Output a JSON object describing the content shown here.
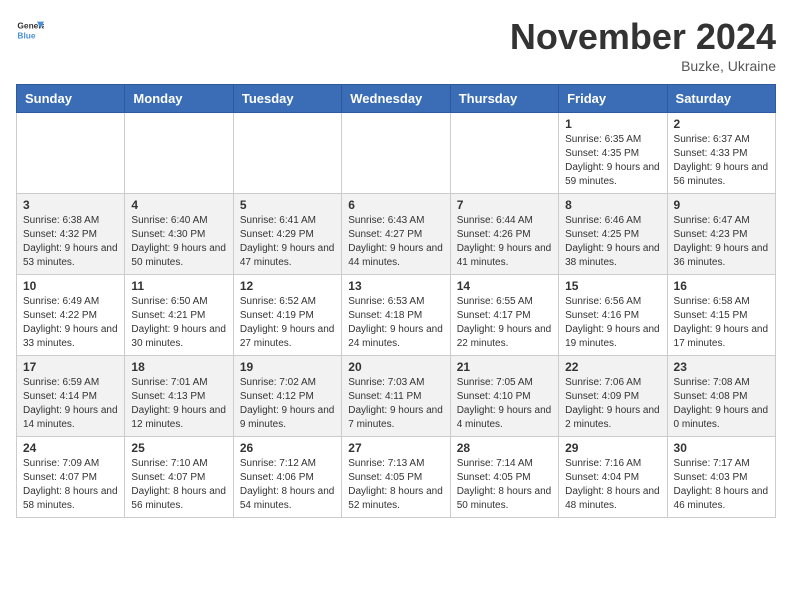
{
  "logo": {
    "text_general": "General",
    "text_blue": "Blue"
  },
  "title": "November 2024",
  "subtitle": "Buzke, Ukraine",
  "days_of_week": [
    "Sunday",
    "Monday",
    "Tuesday",
    "Wednesday",
    "Thursday",
    "Friday",
    "Saturday"
  ],
  "weeks": [
    [
      {
        "day": "",
        "info": ""
      },
      {
        "day": "",
        "info": ""
      },
      {
        "day": "",
        "info": ""
      },
      {
        "day": "",
        "info": ""
      },
      {
        "day": "",
        "info": ""
      },
      {
        "day": "1",
        "info": "Sunrise: 6:35 AM\nSunset: 4:35 PM\nDaylight: 9 hours and 59 minutes."
      },
      {
        "day": "2",
        "info": "Sunrise: 6:37 AM\nSunset: 4:33 PM\nDaylight: 9 hours and 56 minutes."
      }
    ],
    [
      {
        "day": "3",
        "info": "Sunrise: 6:38 AM\nSunset: 4:32 PM\nDaylight: 9 hours and 53 minutes."
      },
      {
        "day": "4",
        "info": "Sunrise: 6:40 AM\nSunset: 4:30 PM\nDaylight: 9 hours and 50 minutes."
      },
      {
        "day": "5",
        "info": "Sunrise: 6:41 AM\nSunset: 4:29 PM\nDaylight: 9 hours and 47 minutes."
      },
      {
        "day": "6",
        "info": "Sunrise: 6:43 AM\nSunset: 4:27 PM\nDaylight: 9 hours and 44 minutes."
      },
      {
        "day": "7",
        "info": "Sunrise: 6:44 AM\nSunset: 4:26 PM\nDaylight: 9 hours and 41 minutes."
      },
      {
        "day": "8",
        "info": "Sunrise: 6:46 AM\nSunset: 4:25 PM\nDaylight: 9 hours and 38 minutes."
      },
      {
        "day": "9",
        "info": "Sunrise: 6:47 AM\nSunset: 4:23 PM\nDaylight: 9 hours and 36 minutes."
      }
    ],
    [
      {
        "day": "10",
        "info": "Sunrise: 6:49 AM\nSunset: 4:22 PM\nDaylight: 9 hours and 33 minutes."
      },
      {
        "day": "11",
        "info": "Sunrise: 6:50 AM\nSunset: 4:21 PM\nDaylight: 9 hours and 30 minutes."
      },
      {
        "day": "12",
        "info": "Sunrise: 6:52 AM\nSunset: 4:19 PM\nDaylight: 9 hours and 27 minutes."
      },
      {
        "day": "13",
        "info": "Sunrise: 6:53 AM\nSunset: 4:18 PM\nDaylight: 9 hours and 24 minutes."
      },
      {
        "day": "14",
        "info": "Sunrise: 6:55 AM\nSunset: 4:17 PM\nDaylight: 9 hours and 22 minutes."
      },
      {
        "day": "15",
        "info": "Sunrise: 6:56 AM\nSunset: 4:16 PM\nDaylight: 9 hours and 19 minutes."
      },
      {
        "day": "16",
        "info": "Sunrise: 6:58 AM\nSunset: 4:15 PM\nDaylight: 9 hours and 17 minutes."
      }
    ],
    [
      {
        "day": "17",
        "info": "Sunrise: 6:59 AM\nSunset: 4:14 PM\nDaylight: 9 hours and 14 minutes."
      },
      {
        "day": "18",
        "info": "Sunrise: 7:01 AM\nSunset: 4:13 PM\nDaylight: 9 hours and 12 minutes."
      },
      {
        "day": "19",
        "info": "Sunrise: 7:02 AM\nSunset: 4:12 PM\nDaylight: 9 hours and 9 minutes."
      },
      {
        "day": "20",
        "info": "Sunrise: 7:03 AM\nSunset: 4:11 PM\nDaylight: 9 hours and 7 minutes."
      },
      {
        "day": "21",
        "info": "Sunrise: 7:05 AM\nSunset: 4:10 PM\nDaylight: 9 hours and 4 minutes."
      },
      {
        "day": "22",
        "info": "Sunrise: 7:06 AM\nSunset: 4:09 PM\nDaylight: 9 hours and 2 minutes."
      },
      {
        "day": "23",
        "info": "Sunrise: 7:08 AM\nSunset: 4:08 PM\nDaylight: 9 hours and 0 minutes."
      }
    ],
    [
      {
        "day": "24",
        "info": "Sunrise: 7:09 AM\nSunset: 4:07 PM\nDaylight: 8 hours and 58 minutes."
      },
      {
        "day": "25",
        "info": "Sunrise: 7:10 AM\nSunset: 4:07 PM\nDaylight: 8 hours and 56 minutes."
      },
      {
        "day": "26",
        "info": "Sunrise: 7:12 AM\nSunset: 4:06 PM\nDaylight: 8 hours and 54 minutes."
      },
      {
        "day": "27",
        "info": "Sunrise: 7:13 AM\nSunset: 4:05 PM\nDaylight: 8 hours and 52 minutes."
      },
      {
        "day": "28",
        "info": "Sunrise: 7:14 AM\nSunset: 4:05 PM\nDaylight: 8 hours and 50 minutes."
      },
      {
        "day": "29",
        "info": "Sunrise: 7:16 AM\nSunset: 4:04 PM\nDaylight: 8 hours and 48 minutes."
      },
      {
        "day": "30",
        "info": "Sunrise: 7:17 AM\nSunset: 4:03 PM\nDaylight: 8 hours and 46 minutes."
      }
    ]
  ]
}
